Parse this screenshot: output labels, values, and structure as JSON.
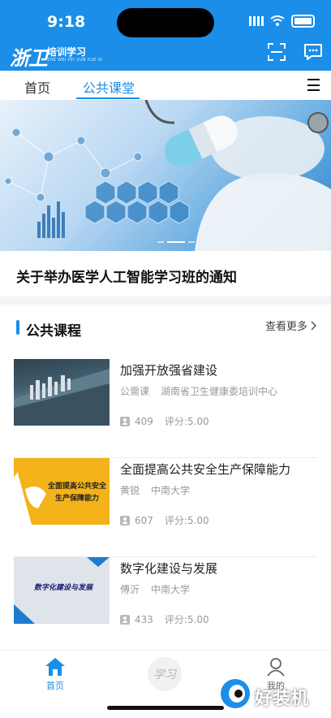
{
  "status_bar": {
    "time": "9:18"
  },
  "header": {
    "logo_mark": "浙卫",
    "logo_text": "培训学习",
    "logo_sub": "ZHE WEI PEI XUN XUE XI",
    "brand_color": "#1a8ee8"
  },
  "tabs": [
    {
      "label": "首页"
    },
    {
      "label": "公共课堂",
      "active": true
    }
  ],
  "banner": {
    "notice": "关于举办医学人工智能学习班的通知",
    "slide_index": 2,
    "slide_count": 3
  },
  "section": {
    "title": "公共课程",
    "more_label": "查看更多"
  },
  "courses": [
    {
      "title": "加强开放强省建设",
      "author": "公需课",
      "org": "湖南省卫生健康委培训中心",
      "learners": "409",
      "score": "评分:5.00",
      "thumb_text": ""
    },
    {
      "title": "全面提高公共安全生产保障能力",
      "author": "黄锐",
      "org": "中南大学",
      "learners": "607",
      "score": "评分:5.00",
      "thumb_text": "全面提高公共安全生产保障能力"
    },
    {
      "title": "数字化建设与发展",
      "author": "傅沂",
      "org": "中南大学",
      "learners": "433",
      "score": "评分:5.00",
      "thumb_text": "数字化建设与发展"
    }
  ],
  "bottom_nav": [
    {
      "label": "首页",
      "icon": "home-icon",
      "active": true
    },
    {
      "label": "学习",
      "icon": "study-icon"
    },
    {
      "label": "我的",
      "icon": "person-icon"
    }
  ],
  "watermark": {
    "text": "好装机"
  }
}
